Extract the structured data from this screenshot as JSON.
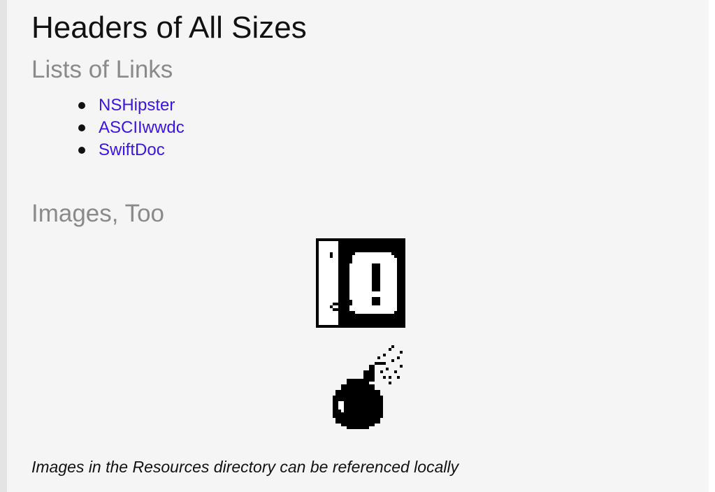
{
  "page": {
    "title": "Headers of All Sizes",
    "links_heading": "Lists of Links",
    "links": [
      {
        "label": "NSHipster"
      },
      {
        "label": "ASCIIwwdc"
      },
      {
        "label": "SwiftDoc"
      }
    ],
    "images_heading": "Images, Too",
    "images": [
      {
        "icon": "alert-face-icon"
      },
      {
        "icon": "bomb-icon"
      }
    ],
    "caption": "Images in the Resources directory can be referenced locally"
  },
  "colors": {
    "background": "#f5f5f5",
    "heading": "#111111",
    "subheading": "#8a8a8a",
    "link": "#3a14e6"
  }
}
